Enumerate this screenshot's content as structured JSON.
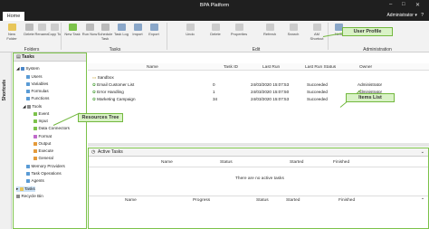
{
  "window": {
    "title": "BPA Platform",
    "minimize": "–",
    "maximize": "□",
    "close": "✕"
  },
  "ribbon_tabs": {
    "home": "Home",
    "user": "Administrator"
  },
  "ribbon": {
    "groups": {
      "folders": "Folders",
      "tasks": "Tasks",
      "edit": "Edit",
      "administration": "Administration"
    },
    "buttons": {
      "new_folder": "New Folder",
      "delete": "Delete",
      "rename": "Rename",
      "copy_to": "Copy To",
      "new_task": "New Task",
      "run_now": "Run Now",
      "schedule": "Schedule Task",
      "task_log": "Task Log",
      "import": "Import",
      "export": "Export",
      "undo": "Undo",
      "delete2": "Delete",
      "properties": "Properties",
      "refresh": "Refresh",
      "search": "Search",
      "am_shortcut": "AM Shortcut",
      "new": "New"
    }
  },
  "shortcuts": {
    "label": "Shortcuts"
  },
  "tree": {
    "header": "Tasks",
    "items": [
      "System",
      "Users",
      "Variables",
      "Formulas",
      "Functions",
      "Tools",
      "Event",
      "Input",
      "Data Connectors",
      "Format",
      "Output",
      "Execute",
      "General",
      "Memory Providers",
      "Task Operations",
      "Agents",
      "Tasks",
      "Recycle Bin"
    ]
  },
  "list": {
    "columns": [
      "Name",
      "Task ID",
      "Last Run",
      "Last Run Status",
      "Owner"
    ],
    "rows": [
      {
        "name": "Sandbox",
        "id": "",
        "last_run": "",
        "status": "",
        "owner": ""
      },
      {
        "name": "Email Customer List",
        "id": "0",
        "last_run": "24/03/2020 15:07:53",
        "status": "Succeeded",
        "owner": "Administrator"
      },
      {
        "name": "Error Handling",
        "id": "1",
        "last_run": "24/03/2020 15:07:50",
        "status": "Succeeded",
        "owner": "Administrator"
      },
      {
        "name": "Marketing Campaign",
        "id": "34",
        "last_run": "24/03/2020 15:07:53",
        "status": "Succeeded",
        "owner": "Administrator"
      }
    ]
  },
  "active": {
    "header": "Active Tasks",
    "columns": [
      "Name",
      "Status",
      "Started",
      "Finished"
    ],
    "empty": "There are no active tasks",
    "columns2": [
      "Name",
      "Progress",
      "Status",
      "Started",
      "Finished"
    ]
  },
  "callouts": {
    "user_profile": "User Profile",
    "items_list": "Items List",
    "resources_tree": "Resources Tree"
  },
  "colors": {
    "accent_green": "#73b83f",
    "callout_fill": "#d9f2c6",
    "titlebar": "#1f1f1f"
  }
}
